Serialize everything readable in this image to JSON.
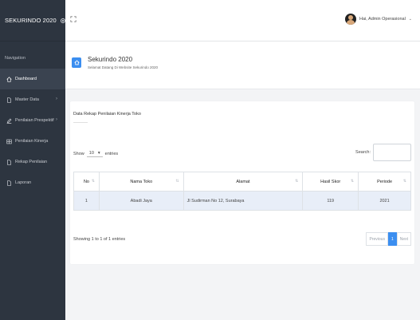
{
  "brand": {
    "name": "SEKURINDO 2020"
  },
  "colors": {
    "sidebar": "#2d3540",
    "accent": "#3b8ef0",
    "row_highlight": "#e8eef8"
  },
  "sidebar": {
    "heading": "Navigation",
    "items": [
      {
        "label": "Dashboard",
        "icon": "home-icon",
        "active": true
      },
      {
        "label": "Master Data",
        "icon": "file-icon",
        "chevron": "›"
      },
      {
        "label": "Penilaian Prespektif",
        "icon": "edit-icon",
        "chevron": "›"
      },
      {
        "label": "Penilaian Kinerja",
        "icon": "table-icon"
      },
      {
        "label": "Rekap Penilaian",
        "icon": "file-icon"
      },
      {
        "label": "Laporan",
        "icon": "file-icon"
      }
    ]
  },
  "header": {
    "expand_icon": "expand-icon",
    "user_greeting": "Hai, Admin Operasional",
    "caret": "⌄"
  },
  "page": {
    "title": "Sekurindo 2020",
    "subtitle": "Selamat Datang Di Website Sekurindo 2020"
  },
  "card": {
    "title": "Data Rekap Penilaian Kinerja Toko",
    "show_label": "Show",
    "entries_value": "10",
    "entries_label": "entries",
    "search_label": "Search:",
    "search_value": "",
    "table": {
      "columns": [
        "No",
        "Nama Toko",
        "Alamat",
        "Hasil Skor",
        "Periode"
      ],
      "rows": [
        [
          "1",
          "Abadi Jaya",
          "Jl Sudirman No 12, Surabaya",
          "119",
          "2021"
        ]
      ]
    },
    "info": "Showing 1 to 1 of 1 entries",
    "pagination": {
      "previous": "Previous",
      "current": "1",
      "next": "Next"
    }
  }
}
